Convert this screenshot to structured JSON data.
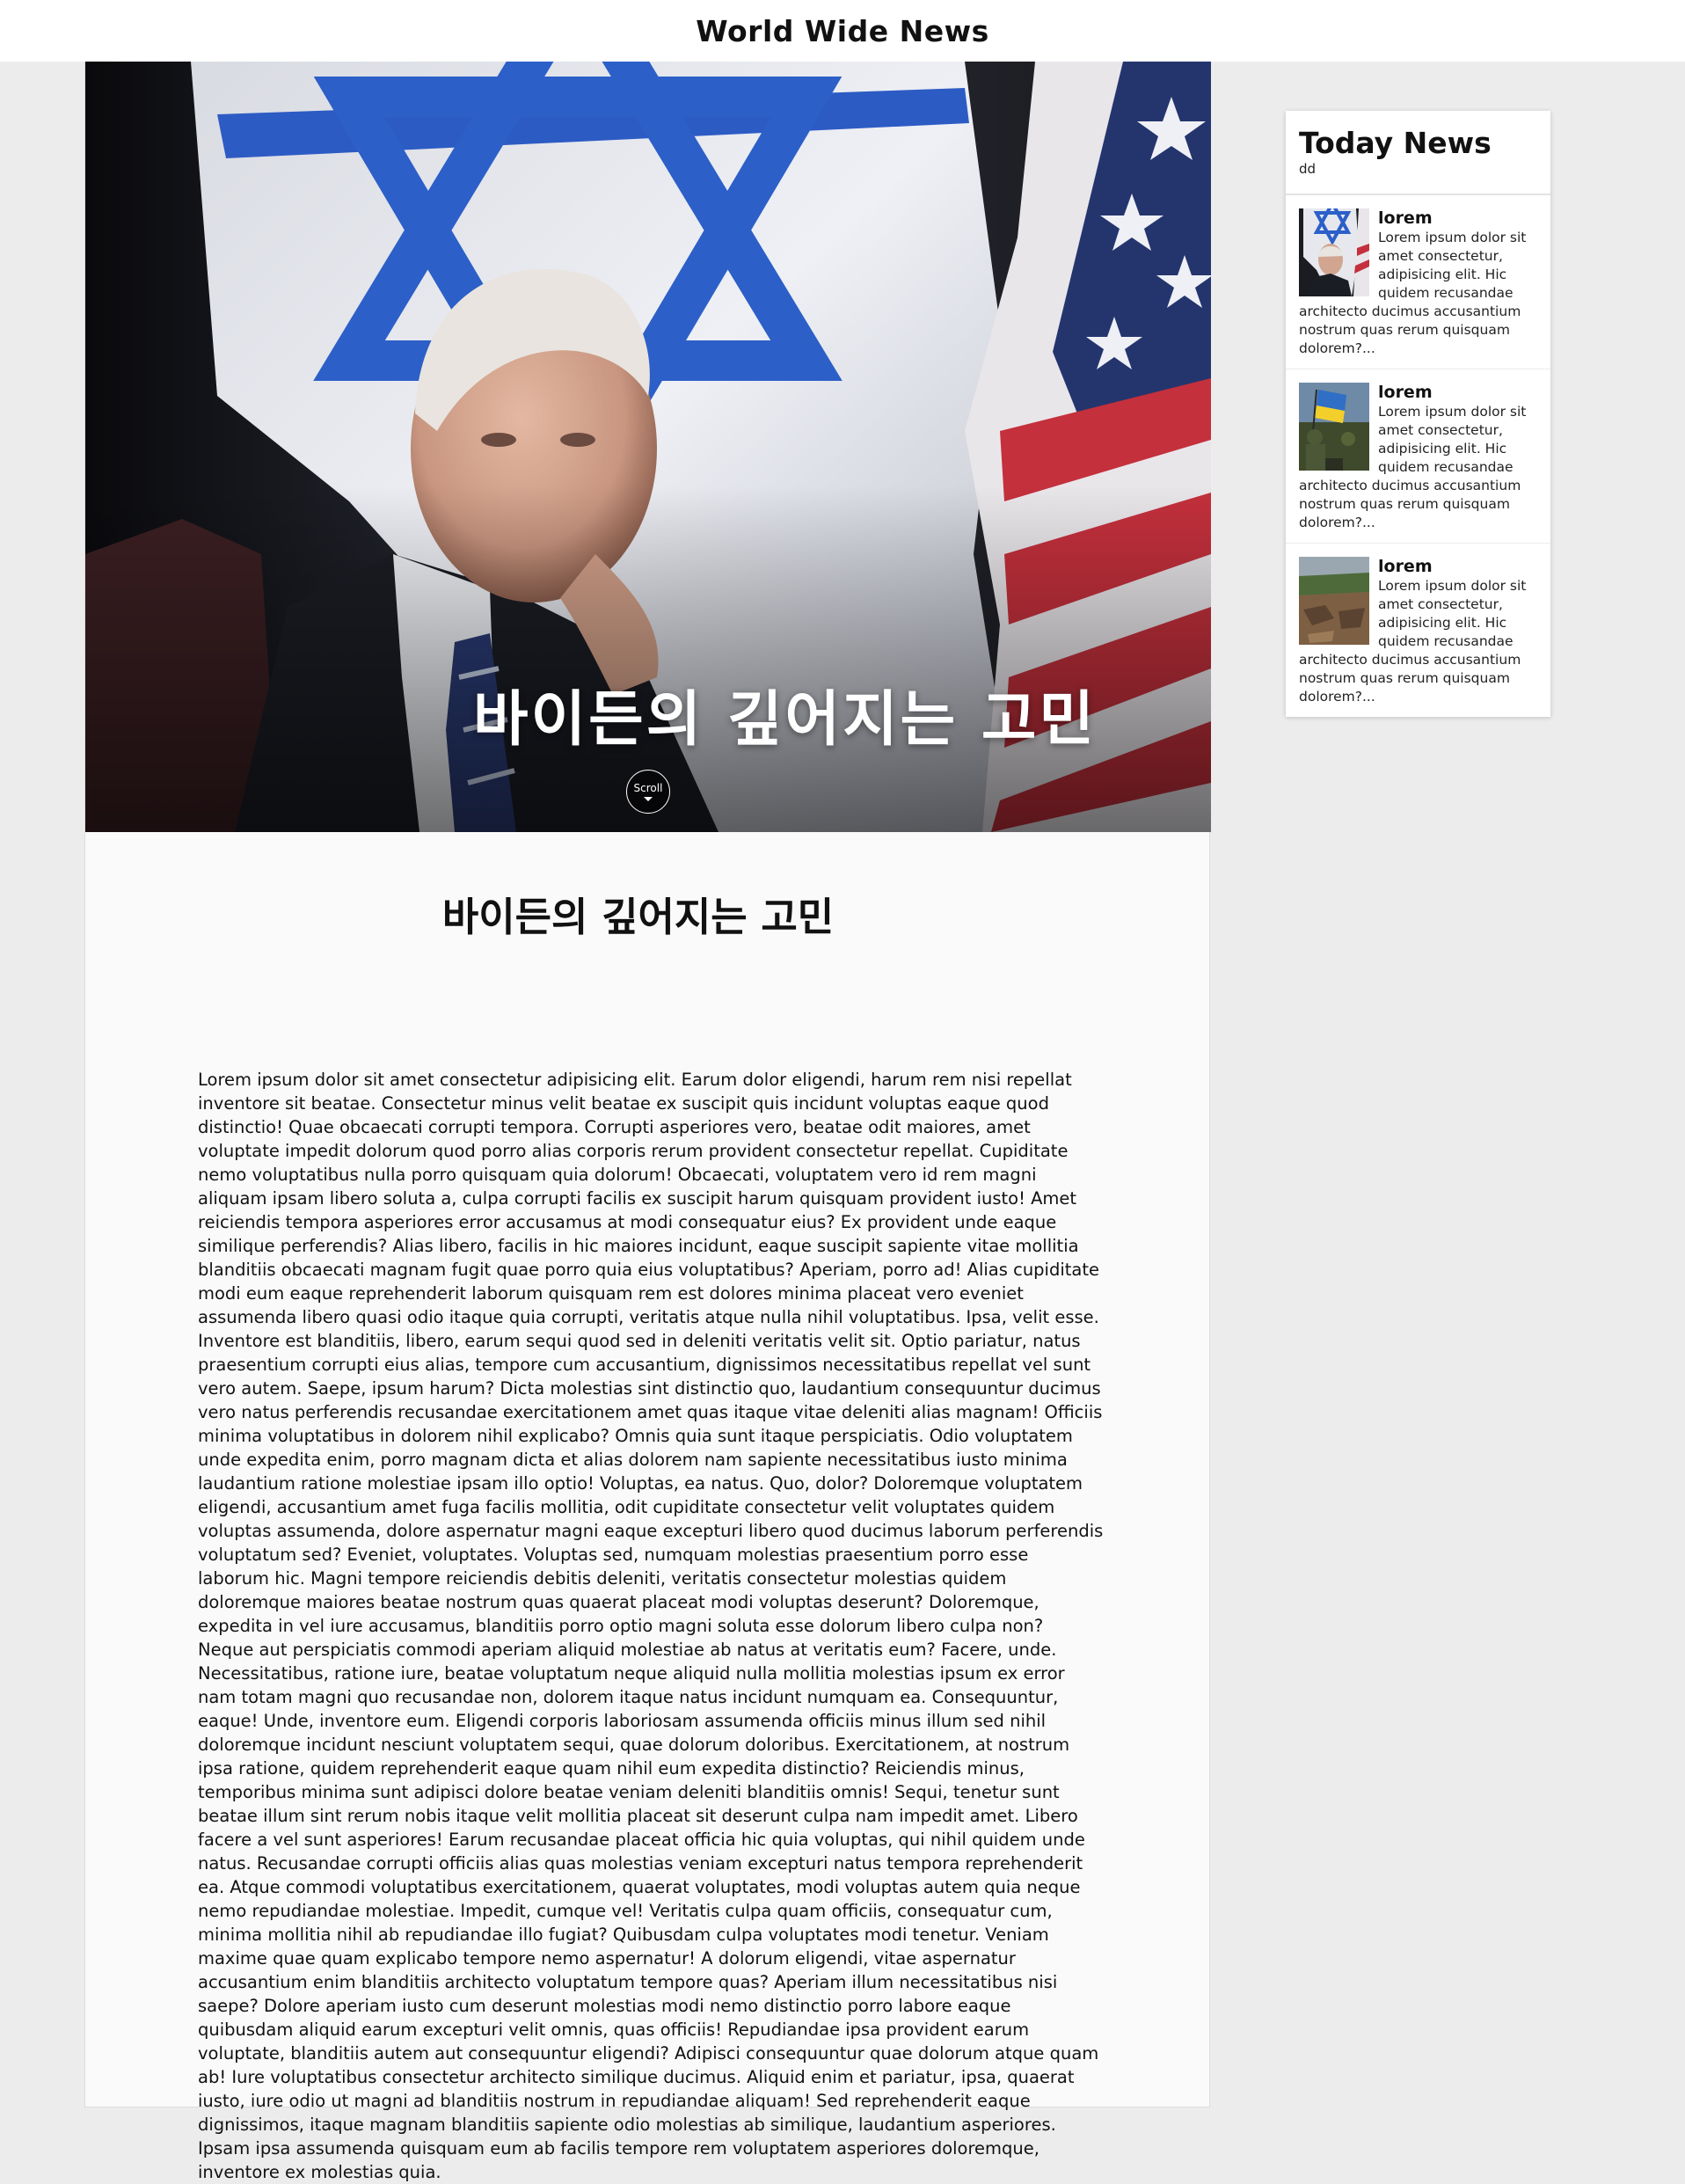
{
  "site": {
    "title": "World Wide News"
  },
  "hero": {
    "title": "바이든의 깊어지는 고민",
    "scroll_label": "Scroll"
  },
  "article": {
    "heading": "바이든의 깊어지는 고민",
    "body": "Lorem ipsum dolor sit amet consectetur adipisicing elit. Earum dolor eligendi, harum rem nisi repellat inventore sit beatae. Consectetur minus velit beatae ex suscipit quis incidunt voluptas eaque quod distinctio! Quae obcaecati corrupti tempora. Corrupti asperiores vero, beatae odit maiores, amet voluptate impedit dolorum quod porro alias corporis rerum provident consectetur repellat. Cupiditate nemo voluptatibus nulla porro quisquam quia dolorum! Obcaecati, voluptatem vero id rem magni aliquam ipsam libero soluta a, culpa corrupti facilis ex suscipit harum quisquam provident iusto! Amet reiciendis tempora asperiores error accusamus at modi consequatur eius? Ex provident unde eaque similique perferendis? Alias libero, facilis in hic maiores incidunt, eaque suscipit sapiente vitae mollitia blanditiis obcaecati magnam fugit quae porro quia eius voluptatibus? Aperiam, porro ad! Alias cupiditate modi eum eaque reprehenderit laborum quisquam rem est dolores minima placeat vero eveniet assumenda libero quasi odio itaque quia corrupti, veritatis atque nulla nihil voluptatibus. Ipsa, velit esse. Inventore est blanditiis, libero, earum sequi quod sed in deleniti veritatis velit sit. Optio pariatur, natus praesentium corrupti eius alias, tempore cum accusantium, dignissimos necessitatibus repellat vel sunt vero autem. Saepe, ipsum harum? Dicta molestias sint distinctio quo, laudantium consequuntur ducimus vero natus perferendis recusandae exercitationem amet quas itaque vitae deleniti alias magnam! Officiis minima voluptatibus in dolorem nihil explicabo? Omnis quia sunt itaque perspiciatis. Odio voluptatem unde expedita enim, porro magnam dicta et alias dolorem nam sapiente necessitatibus iusto minima laudantium ratione molestiae ipsam illo optio! Voluptas, ea natus. Quo, dolor? Doloremque voluptatem eligendi, accusantium amet fuga facilis mollitia, odit cupiditate consectetur velit voluptates quidem voluptas assumenda, dolore aspernatur magni eaque excepturi libero quod ducimus laborum perferendis voluptatum sed? Eveniet, voluptates. Voluptas sed, numquam molestias praesentium porro esse laborum hic. Magni tempore reiciendis debitis deleniti, veritatis consectetur molestias quidem doloremque maiores beatae nostrum quas quaerat placeat modi voluptas deserunt? Doloremque, expedita in vel iure accusamus, blanditiis porro optio magni soluta esse dolorum libero culpa non? Neque aut perspiciatis commodi aperiam aliquid molestiae ab natus at veritatis eum? Facere, unde. Necessitatibus, ratione iure, beatae voluptatum neque aliquid nulla mollitia molestias ipsum ex error nam totam magni quo recusandae non, dolorem itaque natus incidunt numquam ea. Consequuntur, eaque! Unde, inventore eum. Eligendi corporis laboriosam assumenda officiis minus illum sed nihil doloremque incidunt nesciunt voluptatem sequi, quae dolorum doloribus. Exercitationem, at nostrum ipsa ratione, quidem reprehenderit eaque quam nihil eum expedita distinctio? Reiciendis minus, temporibus minima sunt adipisci dolore beatae veniam deleniti blanditiis omnis! Sequi, tenetur sunt beatae illum sint rerum nobis itaque velit mollitia placeat sit deserunt culpa nam impedit amet. Libero facere a vel sunt asperiores! Earum recusandae placeat officia hic quia voluptas, qui nihil quidem unde natus. Recusandae corrupti officiis alias quas molestias veniam excepturi natus tempora reprehenderit ea. Atque commodi voluptatibus exercitationem, quaerat voluptates, modi voluptas autem quia neque nemo repudiandae molestiae. Impedit, cumque vel! Veritatis culpa quam officiis, consequatur cum, minima mollitia nihil ab repudiandae illo fugiat? Quibusdam culpa voluptates modi tenetur. Veniam maxime quae quam explicabo tempore nemo aspernatur! A dolorum eligendi, vitae aspernatur accusantium enim blanditiis architecto voluptatum tempore quas? Aperiam illum necessitatibus nisi saepe? Dolore aperiam iusto cum deserunt molestias modi nemo distinctio porro labore eaque quibusdam aliquid earum excepturi velit omnis, quas officiis! Repudiandae ipsa provident earum voluptate, blanditiis autem aut consequuntur eligendi? Adipisci consequuntur quae dolorum atque quam ab! Iure voluptatibus consectetur architecto similique ducimus. Aliquid enim et pariatur, ipsa, quaerat iusto, iure odio ut magni ad blanditiis nostrum in repudiandae aliquam! Sed reprehenderit eaque dignissimos, itaque magnam blanditiis sapiente odio molestias ab similique, laudantium asperiores. Ipsam ipsa assumenda quisquam eum ab facilis tempore rem voluptatem asperiores doloremque, inventore ex molestias quia."
  },
  "sidebar": {
    "title": "Today News",
    "subtitle": "dd",
    "items": [
      {
        "title": "lorem",
        "text": "Lorem ipsum dolor sit amet consectetur, adipisicing elit. Hic quidem recusandae architecto ducimus accusantium nostrum quas rerum quisquam dolorem?..."
      },
      {
        "title": "lorem",
        "text": "Lorem ipsum dolor sit amet consectetur, adipisicing elit. Hic quidem recusandae architecto ducimus accusantium nostrum quas rerum quisquam dolorem?..."
      },
      {
        "title": "lorem",
        "text": "Lorem ipsum dolor sit amet consectetur, adipisicing elit. Hic quidem recusandae architecto ducimus accusantium nostrum quas rerum quisquam dolorem?..."
      }
    ]
  }
}
